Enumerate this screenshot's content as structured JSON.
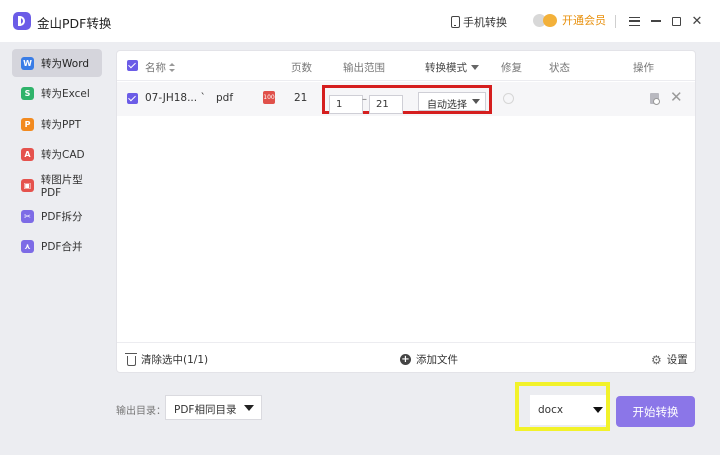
{
  "app": {
    "title": "金山PDF转换"
  },
  "titlebar": {
    "mobile_convert": "手机转换",
    "vip": "开通会员",
    "icons": [
      "phone-icon",
      "vip-crown-icon",
      "menu-icon",
      "minimize-icon",
      "maximize-icon",
      "close-icon"
    ],
    "close_glyph": "✕"
  },
  "sidebar": {
    "items": [
      {
        "label": "转为Word",
        "icon": "W",
        "color": "#3a7de6",
        "active": true
      },
      {
        "label": "转为Excel",
        "icon": "S",
        "color": "#2fb36a",
        "active": false
      },
      {
        "label": "转为PPT",
        "icon": "P",
        "color": "#f28a1f",
        "active": false
      },
      {
        "label": "转为CAD",
        "icon": "A",
        "color": "#e5524d",
        "active": false
      },
      {
        "label": "转图片型PDF",
        "icon": "▣",
        "color": "#e5524d",
        "active": false
      },
      {
        "label": "PDF拆分",
        "icon": "✂",
        "color": "#7d6be6",
        "active": false
      },
      {
        "label": "PDF合并",
        "icon": "⋏",
        "color": "#7d6be6",
        "active": false
      }
    ]
  },
  "table": {
    "headers": {
      "name": "名称",
      "pages": "页数",
      "range": "输出范围",
      "mode": "转换模式",
      "repair": "修复",
      "status": "状态",
      "actions": "操作"
    },
    "rows": [
      {
        "name": "07-JH18... `",
        "ext": "pdf",
        "badge": "100",
        "pages": "21",
        "range_from": "1",
        "range_sep": "–",
        "range_to": "21",
        "mode": "自动选择",
        "remove_glyph": "✕"
      }
    ],
    "footer": {
      "clear": "清除选中(1/1)",
      "add": "添加文件",
      "add_glyph": "+",
      "settings": "设置",
      "settings_glyph": "⚙"
    }
  },
  "bottom": {
    "output_label": "输出目录：",
    "output_dir": "PDF相同目录",
    "format": "docx",
    "start": "开始转换"
  },
  "colors": {
    "accent": "#6b5ce7",
    "start_button": "#8b76e8",
    "vip": "#e8900c",
    "highlight_red": "#d51e1e",
    "highlight_yellow": "#f2f22a"
  }
}
